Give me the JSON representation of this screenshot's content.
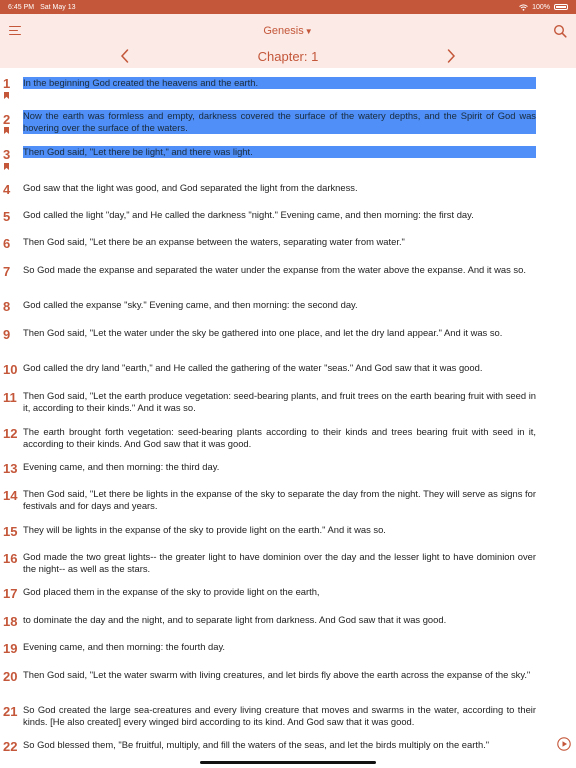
{
  "status": {
    "time": "6:45 PM",
    "date": "Sat May 13",
    "battery": "100%"
  },
  "header": {
    "book": "Genesis",
    "chapter_label": "Chapter: 1"
  },
  "icons": [
    "menu-icon",
    "search-icon",
    "chevron-left-icon",
    "chevron-right-icon",
    "bookmark-icon",
    "play-icon"
  ],
  "colors": {
    "accent": "#c4573a",
    "header_bg": "#fbeae6",
    "highlight": "#4f8ff7"
  },
  "verses": [
    {
      "n": "1",
      "text": "In the beginning God created the heavens and the earth."
    },
    {
      "n": "2",
      "text": "Now the earth was formless and empty, darkness covered the surface of the watery depths, and the Spirit of God was hovering over the surface of the waters."
    },
    {
      "n": "3",
      "text": "Then God said, \"Let there be light,\" and there was light."
    },
    {
      "n": "4",
      "text": "God saw that the light was good, and God separated the light from the darkness."
    },
    {
      "n": "5",
      "text": "God called the light \"day,\" and He called the darkness \"night.\" Evening came, and then morning: the first day."
    },
    {
      "n": "6",
      "text": "Then God said, \"Let there be an expanse between the waters, separating water from water.\""
    },
    {
      "n": "7",
      "text": "So God made the expanse and separated the water under the expanse from the water above the expanse. And it was so."
    },
    {
      "n": "8",
      "text": "God called the expanse \"sky.\" Evening came, and then morning: the second day."
    },
    {
      "n": "9",
      "text": "Then God said, \"Let the water under the sky be gathered into one place, and let the dry land appear.\" And it was so."
    },
    {
      "n": "10",
      "text": "God called the dry land \"earth,\" and He called the gathering of the water \"seas.\" And God saw that it was good."
    },
    {
      "n": "11",
      "text": "Then God said, \"Let the earth produce vegetation: seed-bearing plants, and fruit trees on the earth bearing fruit with seed in it, according to their kinds.\" And it was so."
    },
    {
      "n": "12",
      "text": "The earth brought forth vegetation: seed-bearing plants according to their kinds and trees bearing fruit with seed in it, according to their kinds. And God saw that it was good."
    },
    {
      "n": "13",
      "text": "Evening came, and then morning: the third day."
    },
    {
      "n": "14",
      "text": "Then God said, \"Let there be lights in the expanse of the sky to separate the day from the night. They will serve as signs for festivals and for days and years."
    },
    {
      "n": "15",
      "text": "They will be lights in the expanse of the sky to provide light on the earth.\" And it was so."
    },
    {
      "n": "16",
      "text": "God made the two great lights-- the greater light to have dominion over the day and the lesser light to have dominion over the night-- as well as the stars."
    },
    {
      "n": "17",
      "text": "God placed them in the expanse of the sky to provide light on the earth,"
    },
    {
      "n": "18",
      "text": "to dominate the day and the night, and to separate light from darkness. And God saw that it was good."
    },
    {
      "n": "19",
      "text": "Evening came, and then morning: the fourth day."
    },
    {
      "n": "20",
      "text": "Then God said, \"Let the water swarm with living creatures, and let birds fly above the earth across the expanse of the sky.\""
    },
    {
      "n": "21",
      "text": "So God created the large sea-creatures and every living creature that moves and swarms in the water, according to their kinds. [He also created] every winged bird according to its kind. And God saw that it was good."
    },
    {
      "n": "22",
      "text": "So God blessed them, \"Be fruitful, multiply, and fill the waters of the seas, and let the birds multiply on the earth.\""
    }
  ]
}
